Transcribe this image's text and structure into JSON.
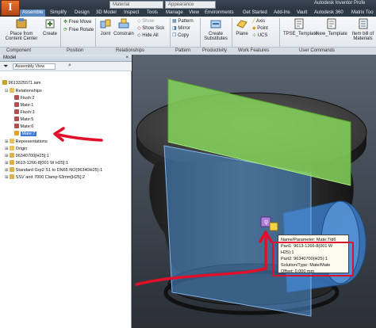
{
  "app": {
    "title": "Autodesk Inventor Profe",
    "material_dropdown": "Material",
    "appearance_dropdown": "Appearance"
  },
  "tabs": [
    "Assemble",
    "Simplify",
    "Design",
    "3D Model",
    "Inspect",
    "Tools",
    "Manage",
    "View",
    "Environments",
    "Get Started",
    "Add-Ins",
    "Vault",
    "Autodesk 360",
    "Matrix Too"
  ],
  "ribbon": {
    "place_from_cc": "Place from Content Center",
    "create": "Create",
    "free_move": "Free Move",
    "free_rotate": "Free Rotate",
    "joint": "Joint",
    "constrain": "Constrain",
    "show": "Show",
    "show_sick": "Show Sick",
    "hide_all": "Hide All",
    "pattern": "Pattern",
    "mirror": "Mirror",
    "copy": "Copy",
    "create_substitutes": "Create Substitutes",
    "plane": "Plane",
    "axis": "Axis",
    "point": "Point",
    "ucs": "UCS",
    "tpse_template": "TPSE_Template",
    "new_template": "New_Template",
    "item_bill": "Item bill of Materials",
    "groups": [
      "Component",
      "Position",
      "Relationships",
      "Pattern",
      "Productivity",
      "Work Features",
      "User Commands"
    ]
  },
  "browser": {
    "panel_title": "Model",
    "view_dropdown": "Assembly View",
    "tree": [
      {
        "label": "9613325571.iam"
      },
      {
        "label": "Relationships"
      },
      {
        "label": "Flush:2"
      },
      {
        "label": "Mate:1"
      },
      {
        "label": "Flush:3"
      },
      {
        "label": "Mate:5"
      },
      {
        "label": "Mate:6"
      },
      {
        "label": "Mate:7"
      },
      {
        "label": "Representations"
      },
      {
        "label": "Origin"
      },
      {
        "label": "96340700[H25]:1"
      },
      {
        "label": "9613-1266-8[001 W H25]:1"
      },
      {
        "label": "Standard Grp2 S1 to DN65 NO(96340H25):1"
      },
      {
        "label": "SSV and 7000 Clamp 63mm[H25]:2"
      }
    ]
  },
  "tooltip": {
    "name": "Name/Parameter: Mate:7/d6",
    "part1": "Part1: 9613-1266-8(001 W H25):1",
    "part2": "Part2: 96340700(H25):1",
    "solution": "Solution/Type: Mate/Mate",
    "offset": "Offset: 0.000 mm"
  },
  "colors": {
    "selection_blue": "#3b78d8",
    "annotation_red": "#e0102a",
    "plane_green": "#86d45c",
    "plane_blue": "#4d8fd6"
  }
}
